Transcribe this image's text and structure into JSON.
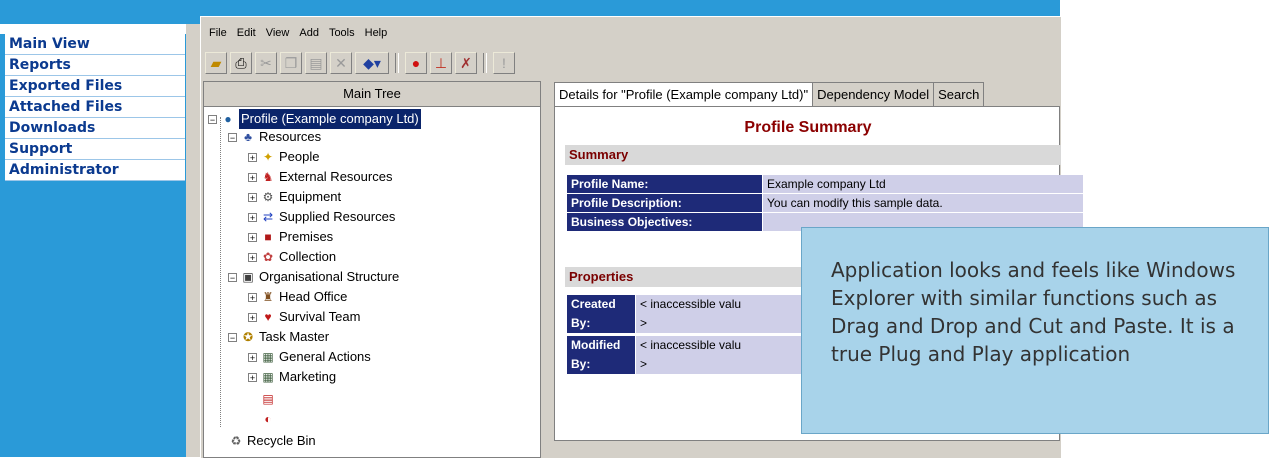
{
  "nav": {
    "items": [
      {
        "label": "Main View"
      },
      {
        "label": "Reports"
      },
      {
        "label": "Exported Files"
      },
      {
        "label": "Attached Files"
      },
      {
        "label": "Downloads"
      },
      {
        "label": "Support"
      },
      {
        "label": "Administrator"
      }
    ]
  },
  "menu": [
    "File",
    "Edit",
    "View",
    "Add",
    "Tools",
    "Help"
  ],
  "toolbar": {
    "icons": [
      "open-folder-icon",
      "print-icon",
      "cut-icon",
      "copy-icon",
      "paste-icon",
      "delete-icon",
      "diamond-dropdown-icon",
      "stop-icon",
      "chart-icon",
      "run-icon",
      "exclamation-icon"
    ]
  },
  "tree": {
    "header": "Main Tree",
    "root": "Profile (Example company Ltd)",
    "resources": "Resources",
    "people": "People",
    "external": "External Resources",
    "equipment": "Equipment",
    "supplied": "Supplied Resources",
    "premises": "Premises",
    "collection": "Collection",
    "org": "Organisational Structure",
    "head_office": "Head Office",
    "survival": "Survival Team",
    "taskmaster": "Task Master",
    "general": "General Actions",
    "marketing": "Marketing",
    "recycle": "Recycle Bin"
  },
  "tabs": [
    {
      "label": "Details for \"Profile (Example company Ltd)\"",
      "active": true
    },
    {
      "label": "Dependency Model",
      "active": false
    },
    {
      "label": "Search",
      "active": false
    }
  ],
  "detail": {
    "title": "Profile Summary",
    "summary_head": "Summary",
    "rows": [
      {
        "k": "Profile Name:",
        "v": "Example company Ltd"
      },
      {
        "k": "Profile Description:",
        "v": "You can modify this sample data."
      },
      {
        "k": "Business Objectives:",
        "v": ""
      }
    ],
    "properties_head": "Properties",
    "props": [
      {
        "k": "Created By:",
        "v1": "< inaccessible valu",
        "v2": ">"
      },
      {
        "k": "Modified By:",
        "v1": "< inaccessible valu",
        "v2": ">"
      }
    ]
  },
  "callout": {
    "text": "Application looks and feels like Windows Explorer with similar functions such as Drag and Drop and Cut and Paste.  It is a true Plug and Play application"
  }
}
